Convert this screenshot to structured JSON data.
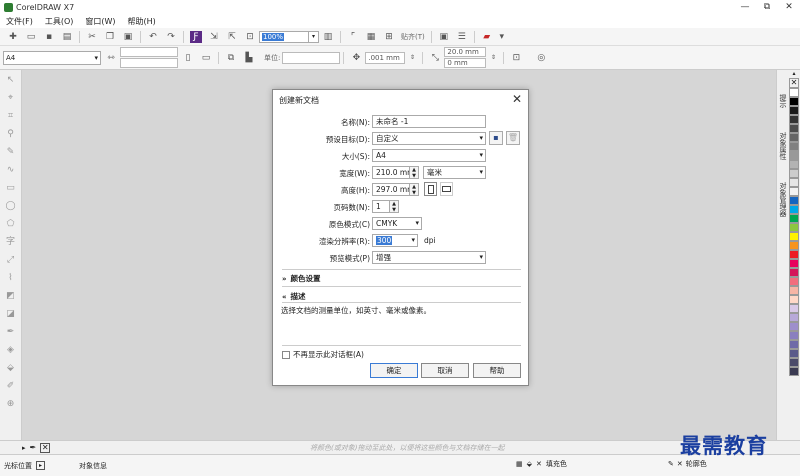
{
  "window": {
    "title": "CorelDRAW X7",
    "minimize": "—",
    "restore": "⧉",
    "close": "✕"
  },
  "menubar": {
    "items": [
      "文件(F)",
      "工具(O)",
      "窗口(W)",
      "帮助(H)"
    ]
  },
  "toolbar": {
    "zoom_value": "100%",
    "snap_label": "贴齐(T)",
    "nudge_value": ".001 mm",
    "dup_x": "20.0 mm",
    "dup_y": "0 mm"
  },
  "propertybar": {
    "page_size": "A4",
    "unit_label": "单位:"
  },
  "dialog": {
    "title": "创建新文档",
    "name_label": "名称(N):",
    "name_value": "未命名 -1",
    "preset_label": "预设目标(D):",
    "preset_value": "自定义",
    "size_label": "大小(S):",
    "size_value": "A4",
    "width_label": "宽度(W):",
    "width_value": "210.0 mm",
    "unit_value": "毫米",
    "height_label": "高度(H):",
    "height_value": "297.0 mm",
    "pages_label": "页码数(N):",
    "pages_value": "1",
    "colormode_label": "原色模式(C)",
    "colormode_value": "CMYK",
    "resolution_label": "渲染分辨率(R):",
    "resolution_value": "300",
    "resolution_unit": "dpi",
    "preview_label": "预览模式(P)",
    "preview_value": "增强",
    "color_settings": "颜色设置",
    "description_header": "描述",
    "description_text": "选择文档的测量单位，如英寸、毫米或像素。",
    "dont_show": "不再显示此对话框(A)",
    "ok": "确定",
    "cancel": "取消",
    "help": "帮助"
  },
  "statusbar": {
    "cursor_label": "光标位置",
    "object_info": "对象信息",
    "fill_label": "填充色",
    "outline_label": "轮廓色"
  },
  "pagebar": {
    "hint": "将颜色(或对象)拖动至此处，以便将这些颜色与文档存储在一起"
  },
  "dockers": {
    "tab1": "提示",
    "tab2": "对象属性",
    "tab3": "对象管理器"
  },
  "watermark": "最需教育",
  "palette_colors": [
    "#ffffff",
    "#000000",
    "#1a1a1a",
    "#333333",
    "#4d4d4d",
    "#666666",
    "#808080",
    "#999999",
    "#b3b3b3",
    "#cccccc",
    "#e6e6e6",
    "#f2f2f2",
    "#1565c0",
    "#00a8e8",
    "#00a651",
    "#8dc63f",
    "#fff200",
    "#f7941d",
    "#ed1c24",
    "#e8005d",
    "#d4145a",
    "#f26d7d",
    "#f7b5a5",
    "#ffd8c8",
    "#d9c9e8",
    "#b8a9d9",
    "#9e8fcc",
    "#8a7fbf",
    "#6f6aa8",
    "#5a5a8a",
    "#4a4a6a",
    "#3a3a52"
  ]
}
